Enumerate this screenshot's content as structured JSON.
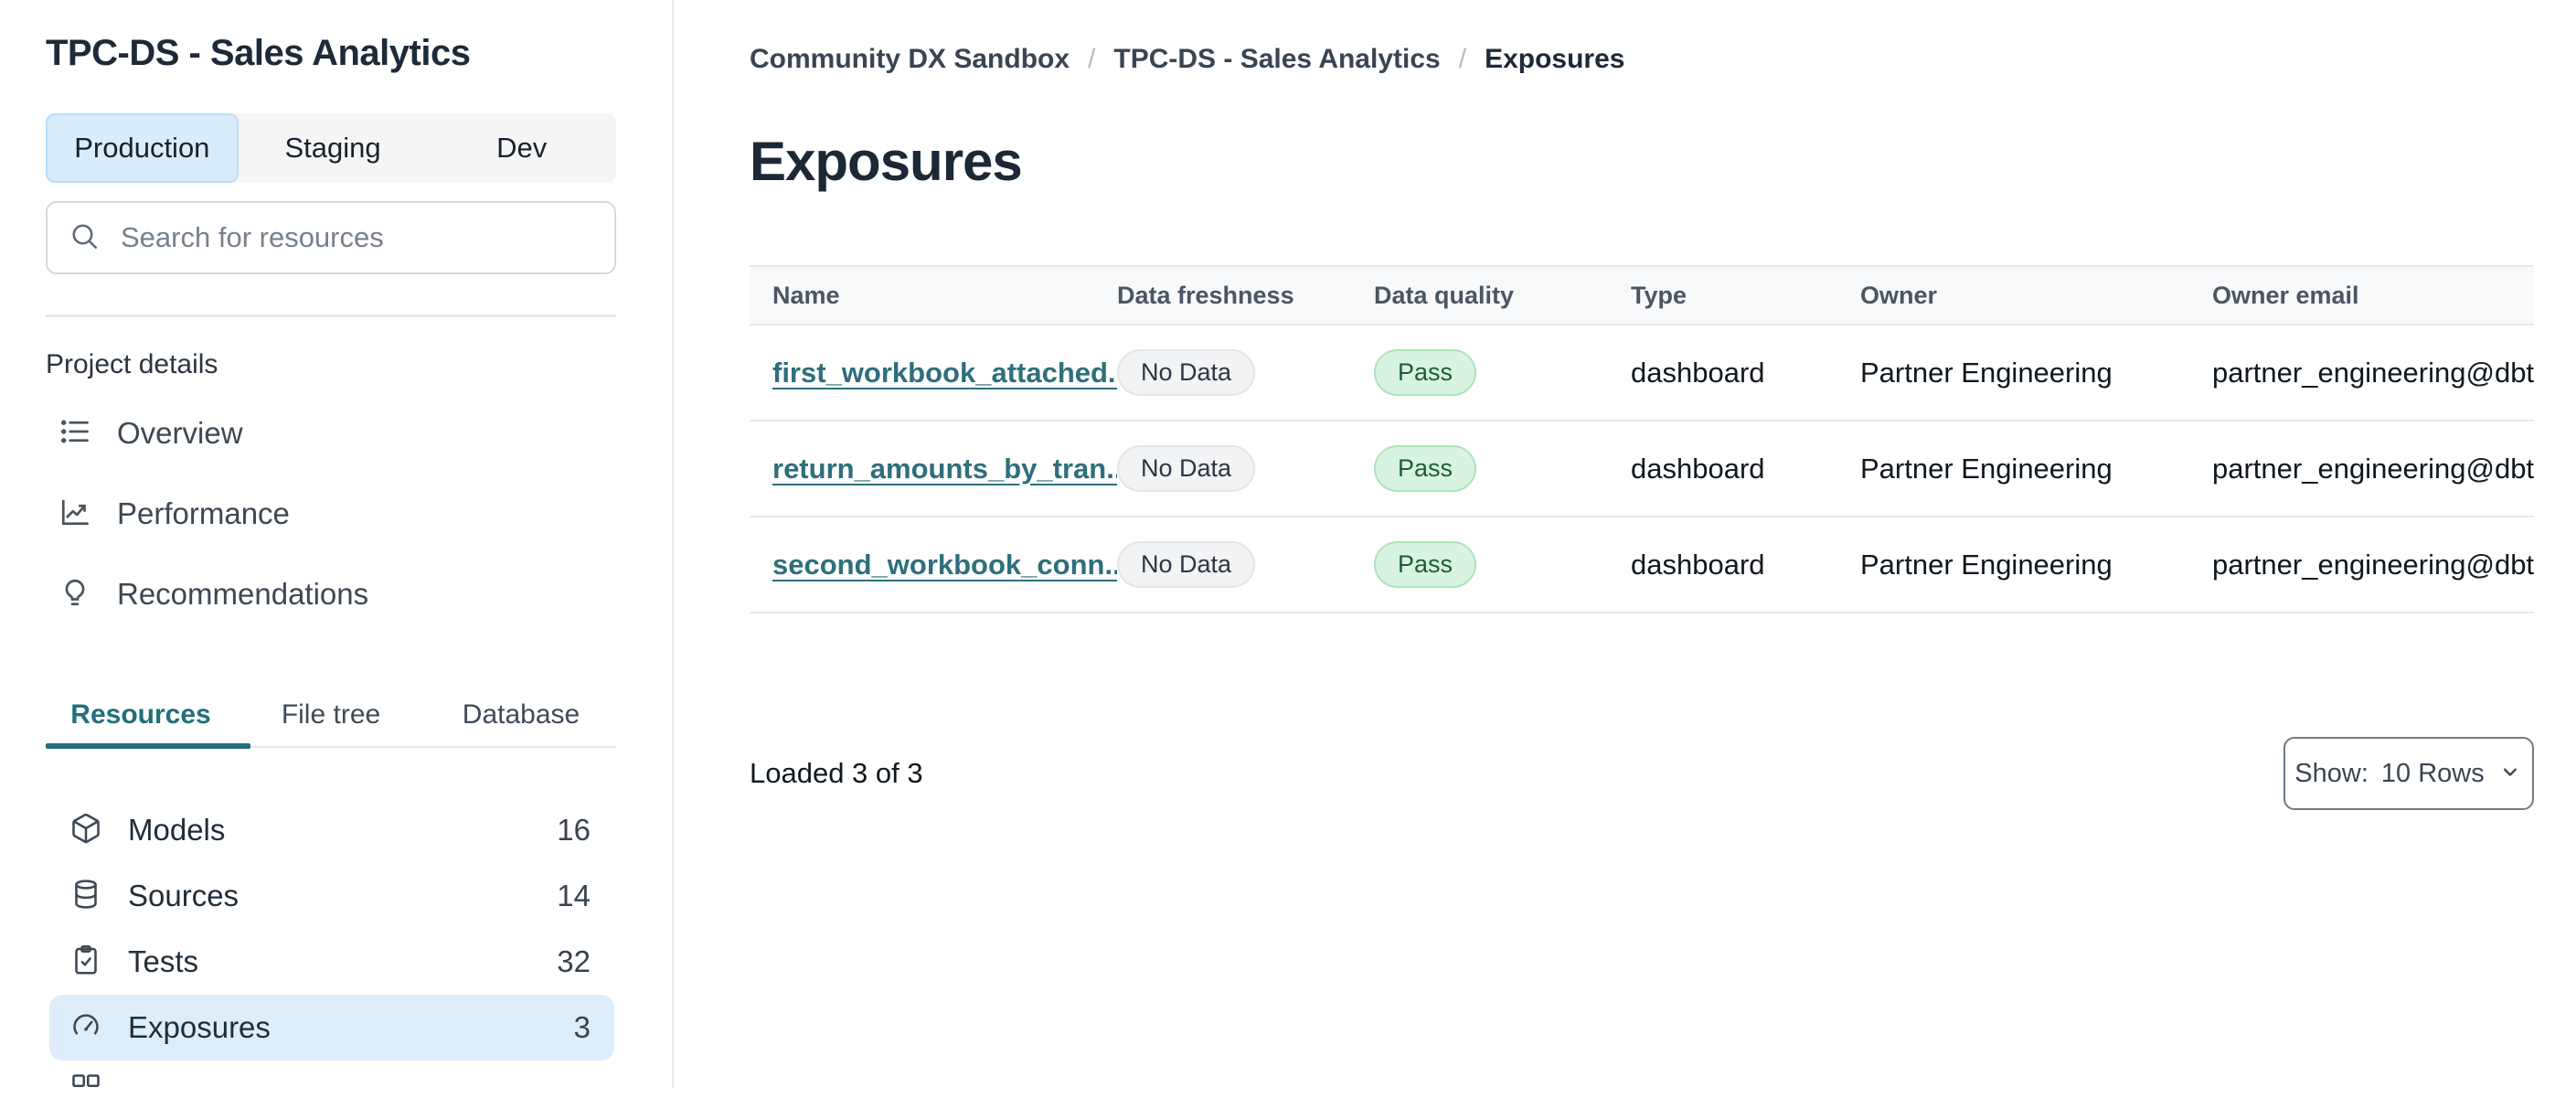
{
  "sidebar": {
    "title": "TPC-DS - Sales Analytics",
    "env_tabs": [
      {
        "label": "Production",
        "active": true
      },
      {
        "label": "Staging",
        "active": false
      },
      {
        "label": "Dev",
        "active": false
      }
    ],
    "search": {
      "placeholder": "Search for resources"
    },
    "section_label": "Project details",
    "nav_items": [
      {
        "icon": "list-icon",
        "label": "Overview"
      },
      {
        "icon": "line-chart-icon",
        "label": "Performance"
      },
      {
        "icon": "lightbulb-icon",
        "label": "Recommendations"
      }
    ],
    "view_tabs": [
      {
        "label": "Resources",
        "active": true
      },
      {
        "label": "File tree",
        "active": false
      },
      {
        "label": "Database",
        "active": false
      }
    ],
    "resources": [
      {
        "icon": "cube-icon",
        "label": "Models",
        "count": "16",
        "active": false
      },
      {
        "icon": "database-icon",
        "label": "Sources",
        "count": "14",
        "active": false
      },
      {
        "icon": "clipboard-check-icon",
        "label": "Tests",
        "count": "32",
        "active": false
      },
      {
        "icon": "gauge-icon",
        "label": "Exposures",
        "count": "3",
        "active": true
      }
    ]
  },
  "main": {
    "breadcrumb": [
      "Community DX Sandbox",
      "TPC-DS - Sales Analytics",
      "Exposures"
    ],
    "breadcrumb_separator": "/",
    "title": "Exposures",
    "table": {
      "columns": [
        "Name",
        "Data freshness",
        "Data quality",
        "Type",
        "Owner",
        "Owner email"
      ],
      "rows": [
        {
          "name": "first_workbook_attached...",
          "freshness": "No Data",
          "quality": "Pass",
          "type": "dashboard",
          "owner": "Partner Engineering",
          "owner_email": "partner_engineering@dbt..."
        },
        {
          "name": "return_amounts_by_tran...",
          "freshness": "No Data",
          "quality": "Pass",
          "type": "dashboard",
          "owner": "Partner Engineering",
          "owner_email": "partner_engineering@dbt..."
        },
        {
          "name": "second_workbook_conn...",
          "freshness": "No Data",
          "quality": "Pass",
          "type": "dashboard",
          "owner": "Partner Engineering",
          "owner_email": "partner_engineering@dbt..."
        }
      ]
    },
    "footer": {
      "loaded_text": "Loaded 3 of 3",
      "show_label": "Show:",
      "show_value": "10 Rows"
    }
  },
  "colors": {
    "accent_teal": "#21707B",
    "link_teal": "#2E6F7B",
    "active_blue": "#D9ECFC",
    "active_row_blue": "#DDEDFB",
    "pass_green_bg": "#D8F3DF",
    "pass_green_border": "#ABE4BC",
    "badge_gray_bg": "#F2F3F5",
    "header_gray_bg": "#F8F9FA"
  }
}
